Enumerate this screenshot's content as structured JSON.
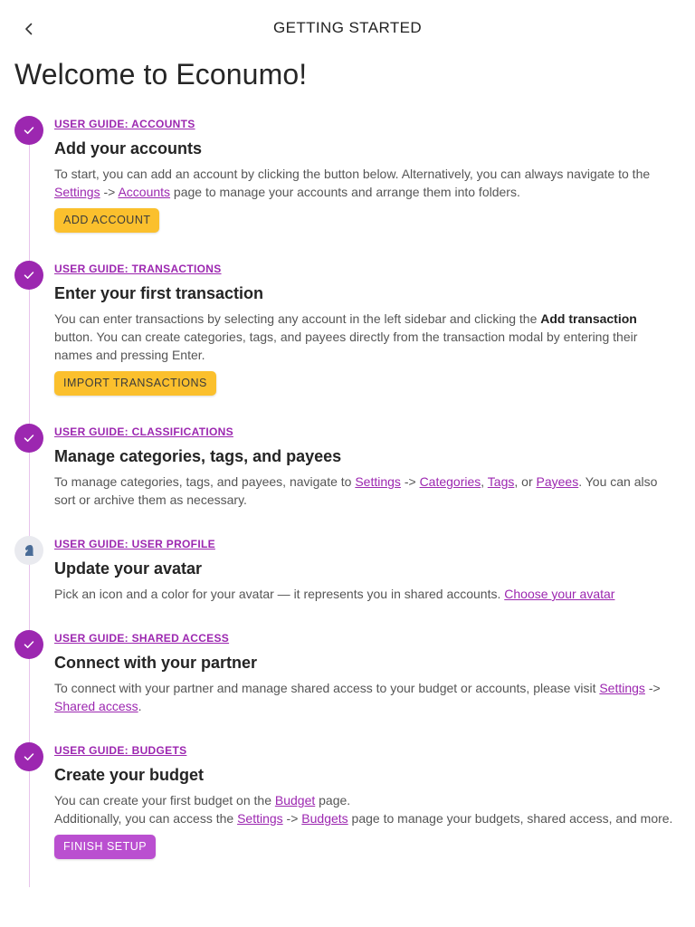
{
  "header": {
    "title": "GETTING STARTED",
    "back_icon": "chevron-left-icon"
  },
  "welcome_title": "Welcome to Econumo!",
  "colors": {
    "accent": "#9c27b0",
    "amber_button": "#fbc02d",
    "finish_button": "#ba4fd0",
    "timeline": "#e7c3ec"
  },
  "steps": [
    {
      "guide": "USER GUIDE: ACCOUNTS",
      "title": "Add your accounts",
      "text_1": "To start, you can add an account by clicking the button below. Alternatively, you can always navigate to the ",
      "link_settings": "Settings",
      "sep": " -> ",
      "link_accounts": "Accounts",
      "text_2": " page to manage your accounts and arrange them into folders.",
      "button": "ADD ACCOUNT",
      "status": "done"
    },
    {
      "guide": "USER GUIDE: TRANSACTIONS",
      "title": "Enter your first transaction",
      "text_1": "You can enter transactions by selecting any account in the left sidebar and clicking the ",
      "bold": "Add transaction",
      "text_2": " button. You can create categories, tags, and payees directly from the transaction modal by entering their names and pressing Enter.",
      "button": "IMPORT TRANSACTIONS",
      "status": "done"
    },
    {
      "guide": "USER GUIDE: CLASSIFICATIONS",
      "title": "Manage categories, tags, and payees",
      "text_1": "To manage categories, tags, and payees, navigate to ",
      "link_settings": "Settings",
      "sep": " -> ",
      "link_categories": "Categories",
      "comma": ", ",
      "link_tags": "Tags",
      "or": ", or ",
      "link_payees": "Payees",
      "text_2": ". You can also sort or archive them as necessary.",
      "status": "done"
    },
    {
      "guide": "USER GUIDE: USER PROFILE",
      "title": "Update your avatar",
      "text_1": "Pick an icon and a color for your avatar — it represents you in shared accounts. ",
      "link_avatar": "Choose your avatar",
      "status": "pending",
      "icon": "chess-knight-icon"
    },
    {
      "guide": "USER GUIDE: SHARED ACCESS",
      "title": "Connect with your partner",
      "text_1": "To connect with your partner and manage shared access to your budget or accounts, please visit ",
      "link_settings": "Settings",
      "sep": " -> ",
      "link_shared": "Shared access",
      "text_2": ".",
      "status": "done"
    },
    {
      "guide": "USER GUIDE: BUDGETS",
      "title": "Create your budget",
      "text_1": "You can create your first budget on the ",
      "link_budget": "Budget",
      "text_2": " page.",
      "text_3": "Additionally, you can access the ",
      "link_settings": "Settings",
      "sep": " -> ",
      "link_budgets": "Budgets",
      "text_4": " page to manage your budgets, shared access, and more.",
      "button": "FINISH SETUP",
      "status": "done"
    }
  ]
}
